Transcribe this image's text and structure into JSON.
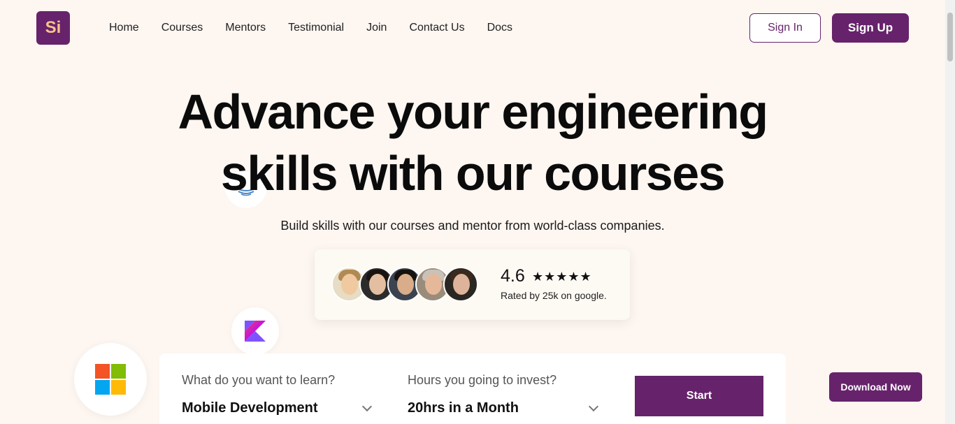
{
  "logo": {
    "text": "Si"
  },
  "nav": {
    "items": [
      "Home",
      "Courses",
      "Mentors",
      "Testimonial",
      "Join",
      "Contact Us",
      "Docs"
    ]
  },
  "auth": {
    "signin_label": "Sign In",
    "signup_label": "Sign Up"
  },
  "hero": {
    "title_line1": "Advance your engineering",
    "title_line2": "skills with our courses",
    "subtitle": "Build skills with our courses and mentor from world-class companies."
  },
  "rating": {
    "value": "4.6",
    "stars": "★★★★★",
    "caption": "Rated by 25k on google."
  },
  "search": {
    "learn_label": "What do you want to learn?",
    "learn_value": "Mobile Development",
    "hours_label": "Hours you going to invest?",
    "hours_value": "20hrs in a Month",
    "start_label": "Start"
  },
  "download_label": "Download Now",
  "colors": {
    "brand": "#66236b",
    "logo_text": "#f6c28b",
    "background": "#fdf6f1"
  },
  "icons": [
    "java-icon",
    "kotlin-icon",
    "microsoft-icon",
    "chevron-down-icon"
  ]
}
